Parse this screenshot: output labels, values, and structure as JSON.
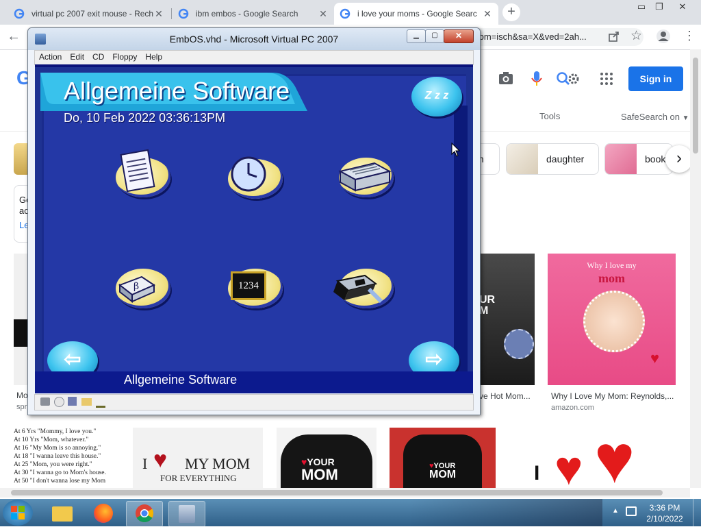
{
  "browser": {
    "tabs": [
      {
        "title": "virtual pc 2007 exit mouse - Rech",
        "active": false
      },
      {
        "title": "ibm embos - Google Search",
        "active": false
      },
      {
        "title": "i love your moms - Google Searc",
        "active": true
      }
    ],
    "address_fragment": "tbm=isch&sa=X&ved=2ah...",
    "new_tab_label": "+"
  },
  "google": {
    "sign_in": "Sign in",
    "tools": "Tools",
    "safesearch": "SafeSearch on",
    "chips": [
      "m",
      "daughter",
      "book"
    ],
    "left_fragments": [
      "Go",
      "ac",
      "Le",
      "Mo",
      "spr"
    ],
    "results": [
      {
        "caption": "ve Hot Mom...",
        "source": ""
      },
      {
        "caption": "Why I Love My Mom: Reynolds,...",
        "source": "amazon.com"
      }
    ],
    "book_title": "Why I love my",
    "book_word": "mom",
    "thumb_text": {
      "list_lines": [
        "At 6 Yrs \"Mommy, I love you.\"",
        "At 10 Yrs \"Mom, whatever.\"",
        "At 16 \"My Mom is so annoying.\"",
        "At 18 \"I wanna leave this house.\"",
        "At 25 \"Mom, you were right.\"",
        "At 30 \"I wanna go to Mom's house.",
        "At 50 \"I don't wanna lose my Mom"
      ],
      "imy_mom": "I",
      "imy_mom_right": "MY MOM",
      "for_everything": "FOR EVERYTHING",
      "hoodie_top": "YOUR",
      "hoodie_bottom": "MOM",
      "tee_top": "YOUR",
      "tee_bottom": "MOM",
      "shirt_top": "UR",
      "shirt_bottom": "M",
      "hearts_i": "I"
    }
  },
  "vpc": {
    "title": "EmbOS.vhd - Microsoft Virtual PC 2007",
    "menu": [
      "Action",
      "Edit",
      "CD",
      "Floppy",
      "Help"
    ],
    "screen": {
      "heading": "Allgemeine Software",
      "datetime": "Do, 10 Feb 2022 03:36:13PM",
      "footer": "Allgemeine Software",
      "sleep_label": "Z z z",
      "icons": [
        "notepad-icon",
        "clock-icon",
        "printer-icon",
        "keyboard-key-icon",
        "calculator-icon",
        "drive-icon"
      ],
      "calc_text": "1234"
    }
  },
  "taskbar": {
    "time": "3:36 PM",
    "date": "2/10/2022"
  }
}
